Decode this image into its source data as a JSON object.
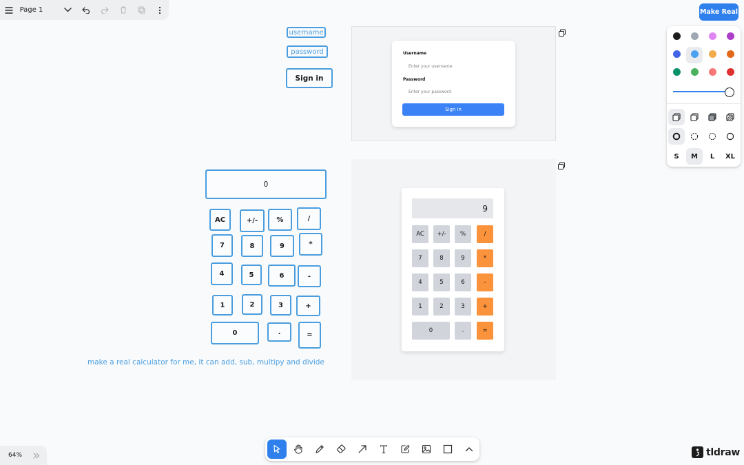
{
  "menu": {
    "page_label": "Page 1",
    "icons": [
      "hamburger-icon",
      "chevron-down-icon",
      "undo-icon",
      "redo-icon",
      "trash-icon",
      "duplicate-icon",
      "more-vertical-icon"
    ]
  },
  "make_real_label": "Make Real",
  "style_panel": {
    "colors": [
      "#1d1d1d",
      "#9fa8b2",
      "#e085f4",
      "#ae3ec9",
      "#4465e9",
      "#4ba1f1",
      "#f1ac4b",
      "#e16919",
      "#099268",
      "#4cb05e",
      "#f87777",
      "#e03131"
    ],
    "selected_color": "#4ba1f1",
    "opacity": 1,
    "sizes": [
      "S",
      "M",
      "L",
      "XL"
    ],
    "selected_size": "M"
  },
  "sketch": {
    "username_label": "username",
    "password_label": "password",
    "signin_label": "Sign in",
    "calc_display": "0",
    "calc_keys": [
      "AC",
      "+/-",
      "%",
      "/",
      "7",
      "8",
      "9",
      "*",
      "4",
      "5",
      "6",
      "-",
      "1",
      "2",
      "3",
      "+",
      "0",
      ".",
      "="
    ],
    "prompt": "make a real calculator for me, it can add, sub, multipy and divide"
  },
  "login_preview": {
    "username_label": "Username",
    "username_placeholder": "Enter your username",
    "password_label": "Password",
    "password_placeholder": "Enter your password",
    "button_label": "Sign in"
  },
  "calc_preview": {
    "display": "9",
    "keys": [
      "AC",
      "+/-",
      "%",
      "/",
      "7",
      "8",
      "9",
      "*",
      "4",
      "5",
      "6",
      "-",
      "1",
      "2",
      "3",
      "+",
      "0",
      ".",
      "="
    ]
  },
  "toolbar": {
    "tools": [
      "select-tool",
      "hand-tool",
      "draw-tool",
      "eraser-tool",
      "arrow-tool",
      "text-tool",
      "note-tool",
      "image-tool",
      "rectangle-tool",
      "more-tools"
    ],
    "selected": "select-tool"
  },
  "zoom": "64%",
  "brand": "tldraw"
}
